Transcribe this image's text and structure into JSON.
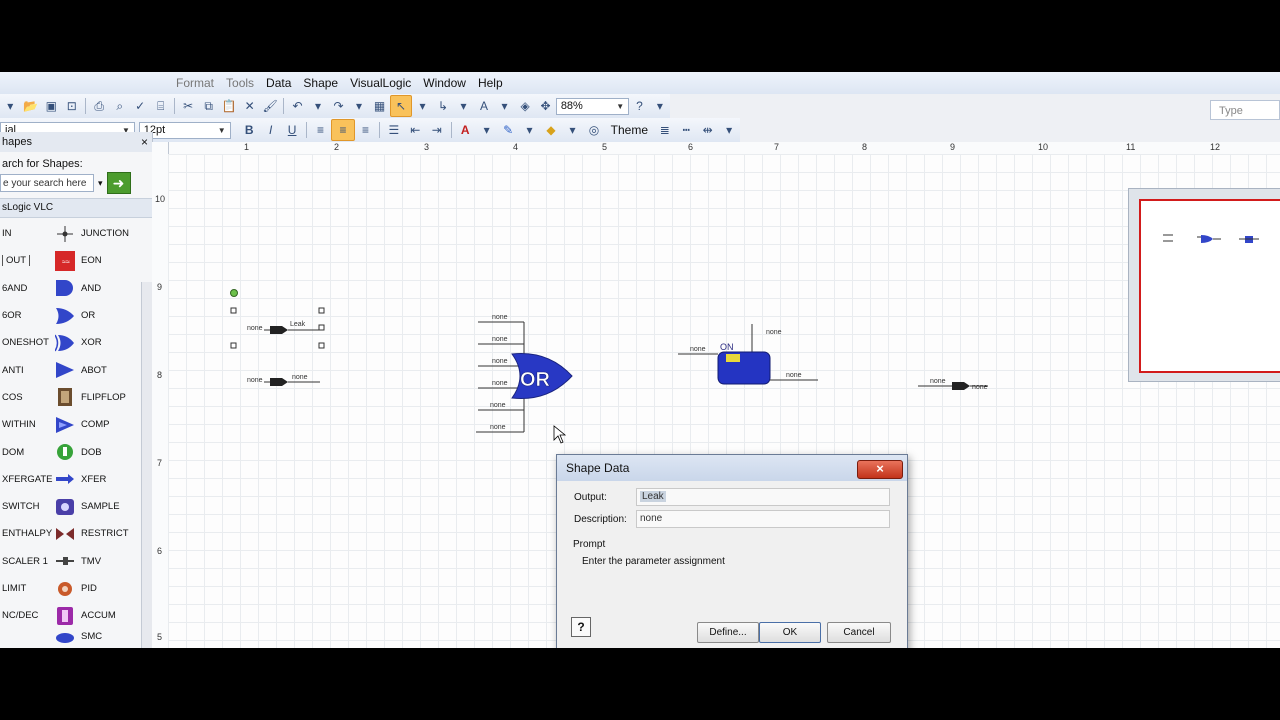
{
  "menubar": {
    "items": [
      "Format",
      "Tools",
      "Data",
      "Shape",
      "VisualLogic",
      "Window",
      "Help"
    ]
  },
  "type_box": {
    "placeholder": "Type"
  },
  "toolbar": {
    "font_name": "ial",
    "font_size": "12pt",
    "zoom": "88%",
    "theme_label": "Theme",
    "bold": "B",
    "italic": "I",
    "underline": "U"
  },
  "shapes_panel": {
    "header": "hapes",
    "close": "×",
    "search_label": "arch for Shapes:",
    "search_placeholder": "e your search here",
    "stencil_title": "sLogic VLC",
    "rows": [
      {
        "left": "IN",
        "right": "JUNCTION",
        "icon": "junction-icon"
      },
      {
        "left": "OUT",
        "right": "EON",
        "icon": "eon-icon"
      },
      {
        "left": "6AND",
        "right": "AND",
        "icon": "and-gate-icon"
      },
      {
        "left": "6OR",
        "right": "OR",
        "icon": "or-gate-icon"
      },
      {
        "left": "ONESHOT",
        "right": "XOR",
        "icon": "xor-gate-icon"
      },
      {
        "left": "ANTI",
        "right": "ABOT",
        "icon": "abot-icon"
      },
      {
        "left": "COS",
        "right": "FLIPFLOP",
        "icon": "flipflop-icon"
      },
      {
        "left": "WITHIN",
        "right": "COMP",
        "icon": "comp-icon"
      },
      {
        "left": "DOM",
        "right": "DOB",
        "icon": "dob-icon"
      },
      {
        "left": "XFERGATE",
        "right": "XFER",
        "icon": "xfer-arrow-icon"
      },
      {
        "left": "SWITCH",
        "right": "SAMPLE",
        "icon": "sample-icon"
      },
      {
        "left": "ENTHALPY",
        "right": "RESTRICT",
        "icon": "restrict-icon"
      },
      {
        "left": "SCALER 1",
        "right": "TMV",
        "icon": "tmv-icon"
      },
      {
        "left": "LIMIT",
        "right": "PID",
        "icon": "pid-icon"
      },
      {
        "left": "NC/DEC",
        "right": "ACCUM",
        "icon": "accum-icon"
      },
      {
        "left": "",
        "right": "SMC",
        "icon": "smc-icon"
      }
    ]
  },
  "ruler": {
    "top": [
      "1",
      "2",
      "3",
      "4",
      "5",
      "6",
      "7",
      "8",
      "9",
      "10",
      "11",
      "12"
    ],
    "left": [
      "10",
      "9",
      "8",
      "7",
      "6",
      "5"
    ]
  },
  "canvas": {
    "leak_label": "Leak",
    "none_label": "none",
    "or_label": "OR",
    "on_label": "ON"
  },
  "dialog": {
    "title": "Shape Data",
    "close": "×",
    "output_label": "Output:",
    "output_value": "Leak",
    "description_label": "Description:",
    "description_value": "none",
    "prompt_label": "Prompt",
    "prompt_text": "Enter the parameter assignment",
    "help": "?",
    "define_button": "Define...",
    "ok_button": "OK",
    "cancel_button": "Cancel"
  }
}
